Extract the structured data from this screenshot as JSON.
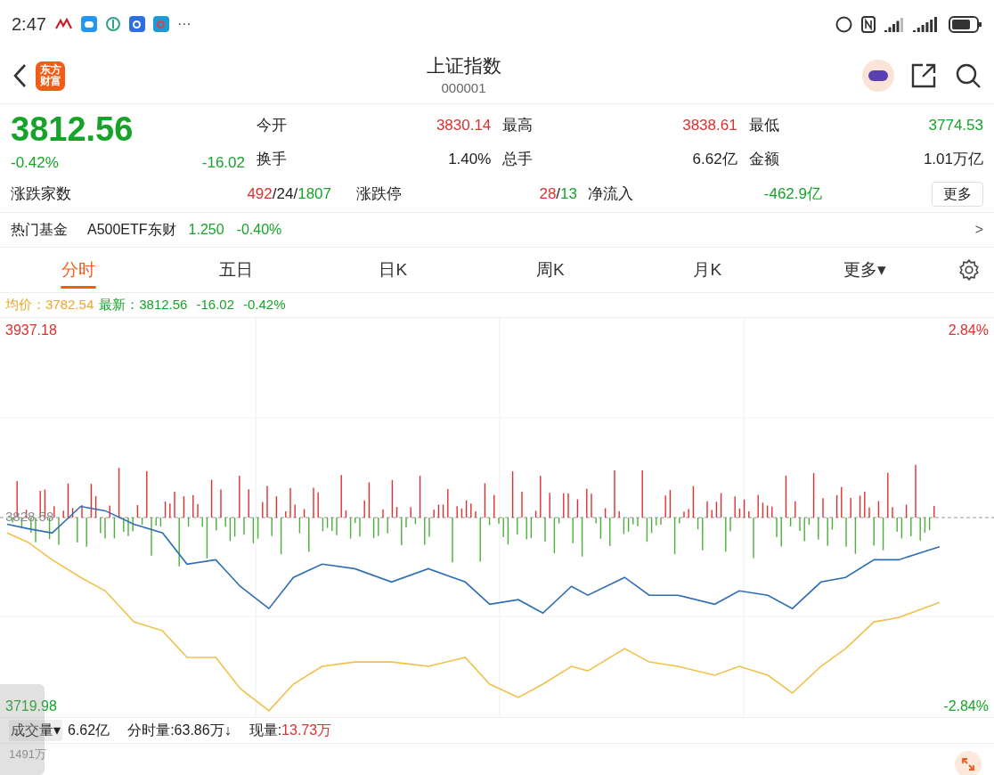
{
  "status_bar": {
    "time": "2:47",
    "more": "···"
  },
  "header": {
    "logo_lines": [
      "东方",
      "财富"
    ],
    "title": "上证指数",
    "code": "000001"
  },
  "quote": {
    "price": "3812.56",
    "color": "#17a32a",
    "change_pct": "-0.42%",
    "change": "-16.02",
    "stats": [
      {
        "label": "今开",
        "value": "3830.14",
        "color": "#e0302e"
      },
      {
        "label": "最高",
        "value": "3838.61",
        "color": "#e0302e"
      },
      {
        "label": "最低",
        "value": "3774.53",
        "color": "#17a32a"
      },
      {
        "label": "换手",
        "value": "1.40%",
        "color": "#222222"
      },
      {
        "label": "总手",
        "value": "6.62亿",
        "color": "#222222"
      },
      {
        "label": "金额",
        "value": "1.01万亿",
        "color": "#222222"
      }
    ],
    "breadth": [
      {
        "label": "涨跌家数",
        "parts": [
          {
            "text": "492",
            "color": "#e0302e"
          },
          {
            "text": "/",
            "color": "#222222"
          },
          {
            "text": "24",
            "color": "#222222"
          },
          {
            "text": "/",
            "color": "#222222"
          },
          {
            "text": "1807",
            "color": "#17a32a"
          }
        ]
      },
      {
        "label": "涨跌停",
        "parts": [
          {
            "text": "28",
            "color": "#e0302e"
          },
          {
            "text": "/",
            "color": "#222222"
          },
          {
            "text": "13",
            "color": "#17a32a"
          }
        ]
      },
      {
        "label": "净流入",
        "parts": [
          {
            "text": "-462.9亿",
            "color": "#17a32a"
          }
        ]
      }
    ],
    "more_button": "更多"
  },
  "fund_row": {
    "label": "热门基金",
    "name": "A500ETF东财",
    "price": "1.250",
    "change": "-0.40%",
    "color": "#17a32a",
    "chevron": ">"
  },
  "tabs": [
    {
      "label": "分时",
      "selected": true
    },
    {
      "label": "五日",
      "selected": false
    },
    {
      "label": "日K",
      "selected": false
    },
    {
      "label": "周K",
      "selected": false
    },
    {
      "label": "月K",
      "selected": false
    },
    {
      "label": "更多▾",
      "selected": false
    }
  ],
  "legend": {
    "avg_label": "均价：",
    "avg_value": "3782.54",
    "last_label": "最新：",
    "last_value": "3812.56",
    "change": "-16.02",
    "change_pct": "-0.42%"
  },
  "chart": {
    "y_high": "3937.18",
    "y_base": "3828.58",
    "y_low": "3719.98",
    "pct_high": "2.84%",
    "pct_low": "-2.84%"
  },
  "volume_bar": {
    "selector": "成交量▾",
    "total": "6.62亿",
    "minute_label": "分时量:",
    "minute_value": "63.86万↓",
    "now_label": "现量:",
    "now_value": "13.73万"
  },
  "volume_chart": {
    "max_label": "1491万"
  }
}
